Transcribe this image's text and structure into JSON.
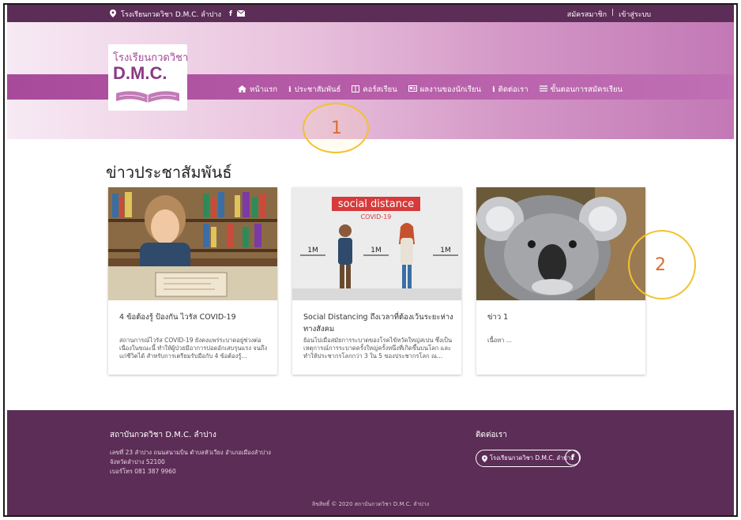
{
  "topbar": {
    "location": "โรงเรียนกวดวิชา D.M.C. ลำปาง",
    "register": "สมัครสมาชิก",
    "separator": "|",
    "login": "เข้าสู่ระบบ"
  },
  "logo": {
    "line1": "โรงเรียนกวดวิชา",
    "line2": "D.M.C."
  },
  "nav": [
    {
      "label": "หน้าแรก",
      "icon": "home-icon"
    },
    {
      "label": "ประชาสัมพันธ์",
      "icon": "info-icon"
    },
    {
      "label": "คอร์สเรียน",
      "icon": "book-icon"
    },
    {
      "label": "ผลงานของนักเรียน",
      "icon": "id-card-icon"
    },
    {
      "label": "ติดต่อเรา",
      "icon": "info-icon"
    },
    {
      "label": "ขั้นตอนการสมัครเรียน",
      "icon": "list-icon"
    }
  ],
  "annotations": {
    "a1": "1",
    "a2": "2"
  },
  "section_title": "ข่าวประชาสัมพันธ์",
  "cards": [
    {
      "title": "4 ข้อต้องรู้ ป้องกัน ไวรัส COVID-19",
      "excerpt": "สถานการณ์ไวรัส COVID-19 ยังคงแพร่ระบาดอยู่ช่วงต่อเนื่องในขณะนี้ ทำให้ผู้ป่วยมีอาการปอดอักเสบรุนแรง จนถึงแก่ชีวิตได้ สำหรับการเตรียมรับมือกับ 4 ข้อต้องรู้..."
    },
    {
      "title": "Social Distancing ถึงเวลาที่ต้องเว้นระยะห่างทางสังคม",
      "excerpt": "ย้อนไปเมื่อสมัยการระบาดของโรคไข้หวัดใหญ่สเปน ซึ่งเป็นเหตุการณ์การระบาดครั้งใหญ่ครั้งหนึ่งที่เกิดขึ้นบนโลก และทำให้ประชากรโลกกว่า 3 ใน 5 ของประชากรโลก ณ..."
    },
    {
      "title": "ข่าว 1",
      "excerpt": "เนื้อหา ..."
    }
  ],
  "card2_image": {
    "banner": "social distance",
    "sub": "COVID-19",
    "m1": "1M",
    "m2": "1M",
    "m3": "1M"
  },
  "footer": {
    "org": "สถาบันกวดวิชา D.M.C. ลำปาง",
    "addr1": "เลขที่ 23 ลำปาง ถนนสนามบิน ตำบลหัวเวียง อำเภอเมืองลำปาง",
    "addr2": "จังหวัดลำปาง 52100",
    "addr3": "เบอร์โทร 081 387 9960",
    "contact": "ติดต่อเรา",
    "pill": "โรงเรียนกวดวิชา D.M.C. ลำปาง",
    "fb": "f",
    "copyright": "ลิขสิทธิ์ © 2020 สถาบันกวดวิชา D.M.C. ลำปาง"
  }
}
